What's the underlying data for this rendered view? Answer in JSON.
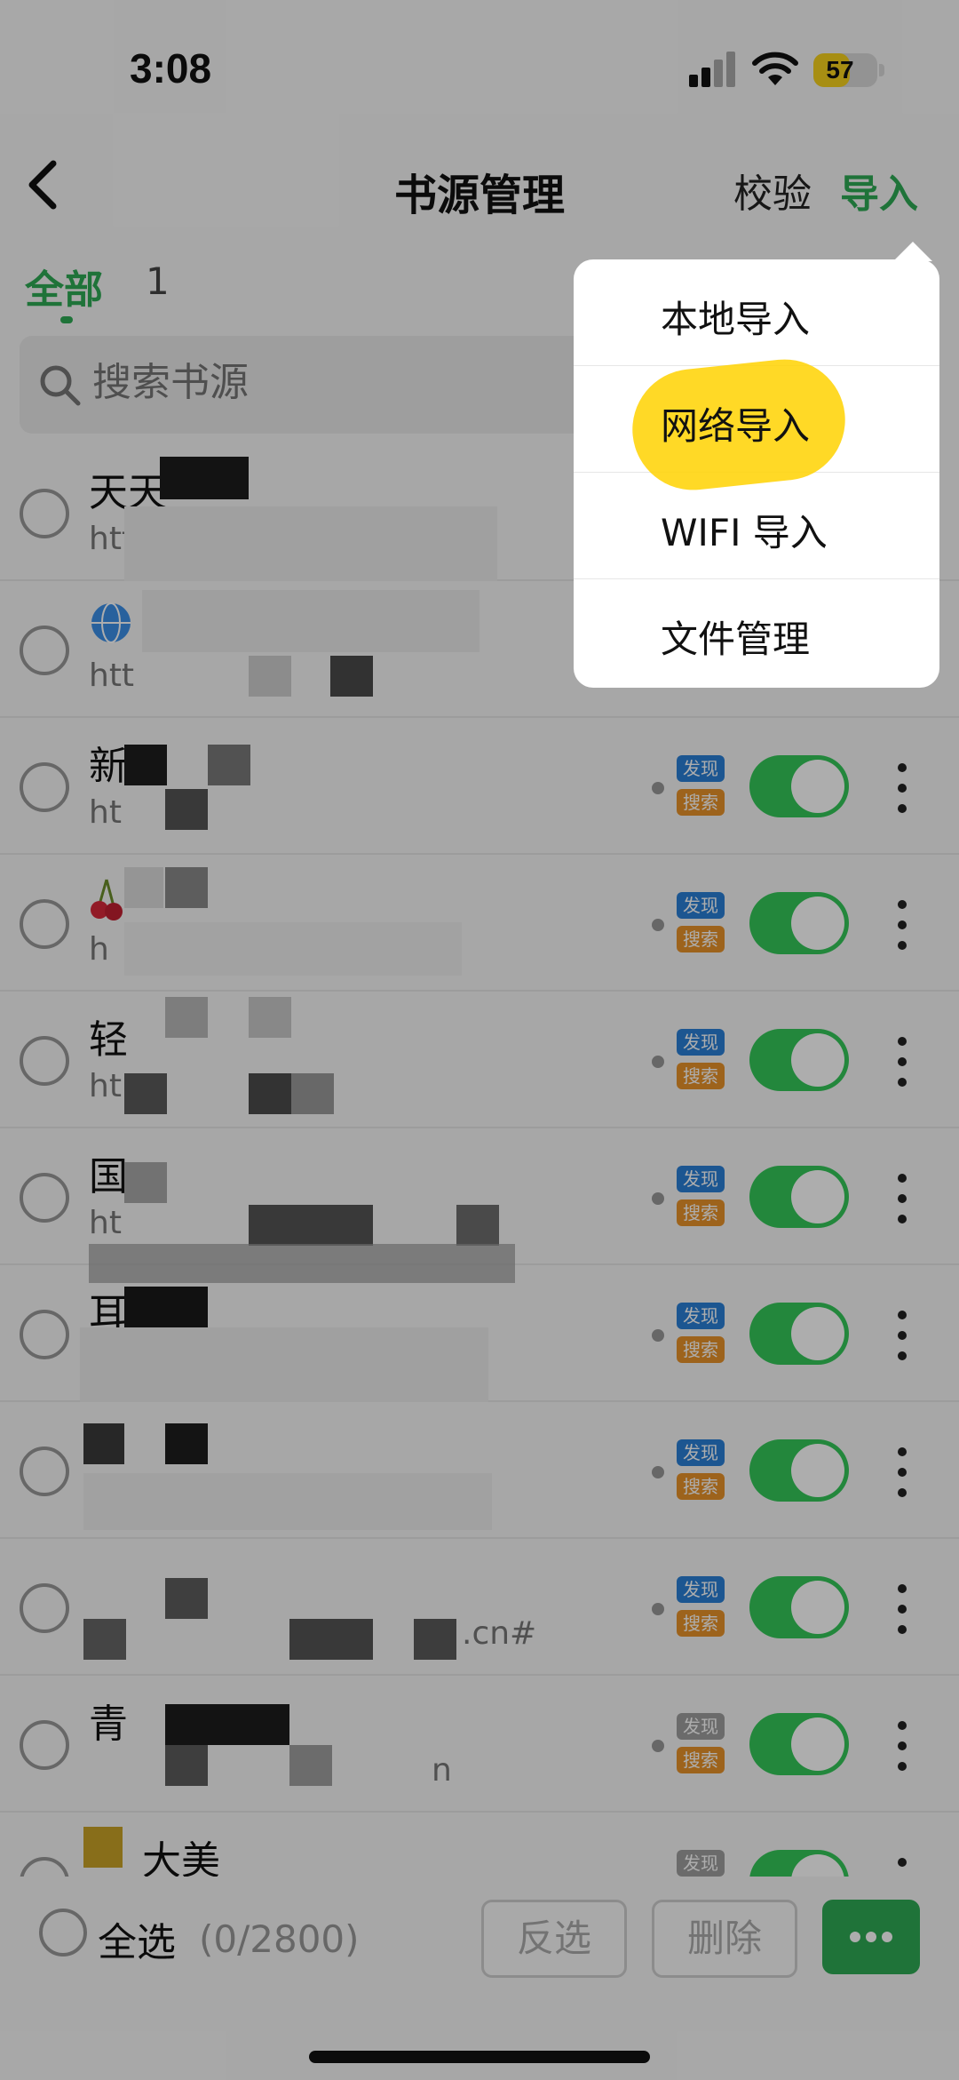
{
  "status_bar": {
    "time": "3:08",
    "battery": "57",
    "battery_level": 0.57
  },
  "nav": {
    "title": "书源管理",
    "check_label": "校验",
    "import_label": "导入"
  },
  "tabs": [
    {
      "label": "全部",
      "active": true
    },
    {
      "label": "1",
      "active": false
    }
  ],
  "search": {
    "placeholder": "搜索书源"
  },
  "sources": [
    {
      "name": "天天",
      "url": "http"
    },
    {
      "name": "",
      "url": "htt"
    },
    {
      "name": "新",
      "url": "ht"
    },
    {
      "name": "",
      "url": "h"
    },
    {
      "name": "轻",
      "url": "ht"
    },
    {
      "name": "国",
      "url": "ht"
    },
    {
      "name": "耳",
      "url": ""
    },
    {
      "name": "",
      "url": ""
    },
    {
      "name": "",
      "url": ".cn#"
    },
    {
      "name": "青",
      "url": "n"
    },
    {
      "name": "大美",
      "url": ""
    }
  ],
  "tags": {
    "discover": "发现",
    "search": "搜索"
  },
  "footer": {
    "select_all": "全选",
    "count": "(0/2800)",
    "invert": "反选",
    "delete": "删除"
  },
  "import_menu": {
    "items": [
      "本地导入",
      "网络导入",
      "WIFI 导入",
      "文件管理"
    ],
    "highlighted_index": 1
  },
  "colors": {
    "accent": "#2eaa55",
    "toggle_on": "#34c759",
    "tag_discover": "#2a7fd6",
    "tag_discover_grey": "#9e9e9e",
    "tag_search": "#e8932a",
    "highlight": "#ffd200"
  }
}
